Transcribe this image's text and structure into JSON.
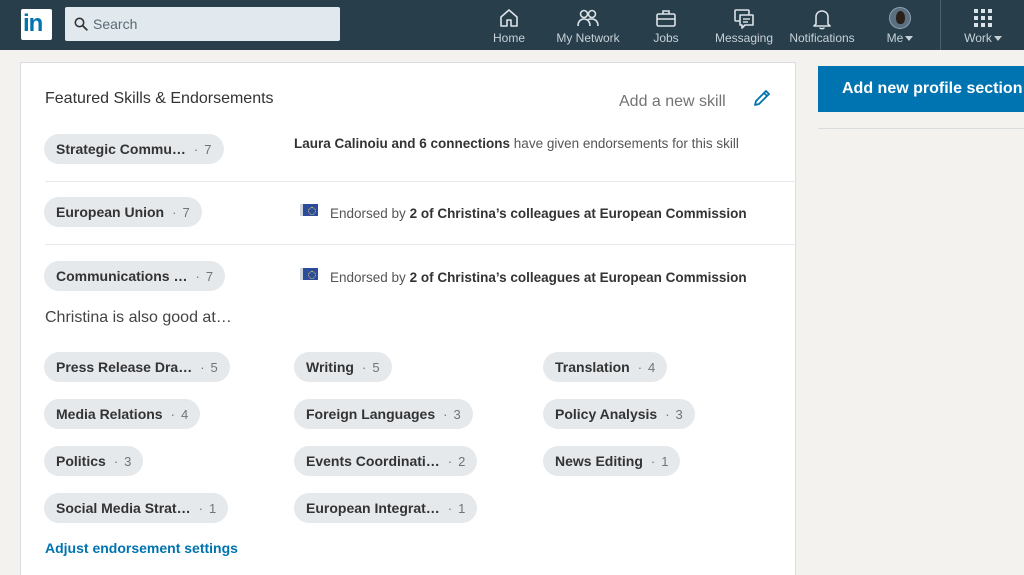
{
  "nav": {
    "search_placeholder": "Search",
    "items": [
      {
        "label": "Home",
        "icon": "home-icon"
      },
      {
        "label": "My Network",
        "icon": "network-icon"
      },
      {
        "label": "Jobs",
        "icon": "briefcase-icon"
      },
      {
        "label": "Messaging",
        "icon": "messaging-icon"
      },
      {
        "label": "Notifications",
        "icon": "bell-icon"
      },
      {
        "label": "Me",
        "icon": "avatar"
      },
      {
        "label": "Work",
        "icon": "grid-icon"
      }
    ]
  },
  "colors": {
    "nav_bg": "#283e4a",
    "brand": "#0073b1",
    "pill_bg": "#e6e9ec"
  },
  "card": {
    "title": "Featured Skills & Endorsements",
    "add_skill": "Add a new skill",
    "featured": [
      {
        "name": "Strategic Commu…",
        "count": "7"
      },
      {
        "name": "European Union",
        "count": "7"
      },
      {
        "name": "Communications …",
        "count": "7"
      }
    ],
    "endorsements": [
      {
        "bold": "Laura Calinoiu and 6 connections",
        "text": " have given endorsements for this skill"
      },
      {
        "prefix": "Endorsed by ",
        "bold": "2 of Christina’s colleagues at European Commission"
      },
      {
        "prefix": "Endorsed by ",
        "bold": "2 of Christina’s colleagues at European Commission"
      }
    ],
    "also_good": "Christina is also good at…",
    "other_skills": [
      {
        "name": "Press Release Dra…",
        "count": "5"
      },
      {
        "name": "Writing",
        "count": "5"
      },
      {
        "name": "Translation",
        "count": "4"
      },
      {
        "name": "Media Relations",
        "count": "4"
      },
      {
        "name": "Foreign Languages",
        "count": "3"
      },
      {
        "name": "Policy Analysis",
        "count": "3"
      },
      {
        "name": "Politics",
        "count": "3"
      },
      {
        "name": "Events Coordinati…",
        "count": "2"
      },
      {
        "name": "News Editing",
        "count": "1"
      },
      {
        "name": "Social Media Strat…",
        "count": "1"
      },
      {
        "name": "European Integrat…",
        "count": "1"
      }
    ],
    "adjust_link": "Adjust endorsement settings"
  },
  "rail": {
    "add_section": "Add new profile section"
  }
}
